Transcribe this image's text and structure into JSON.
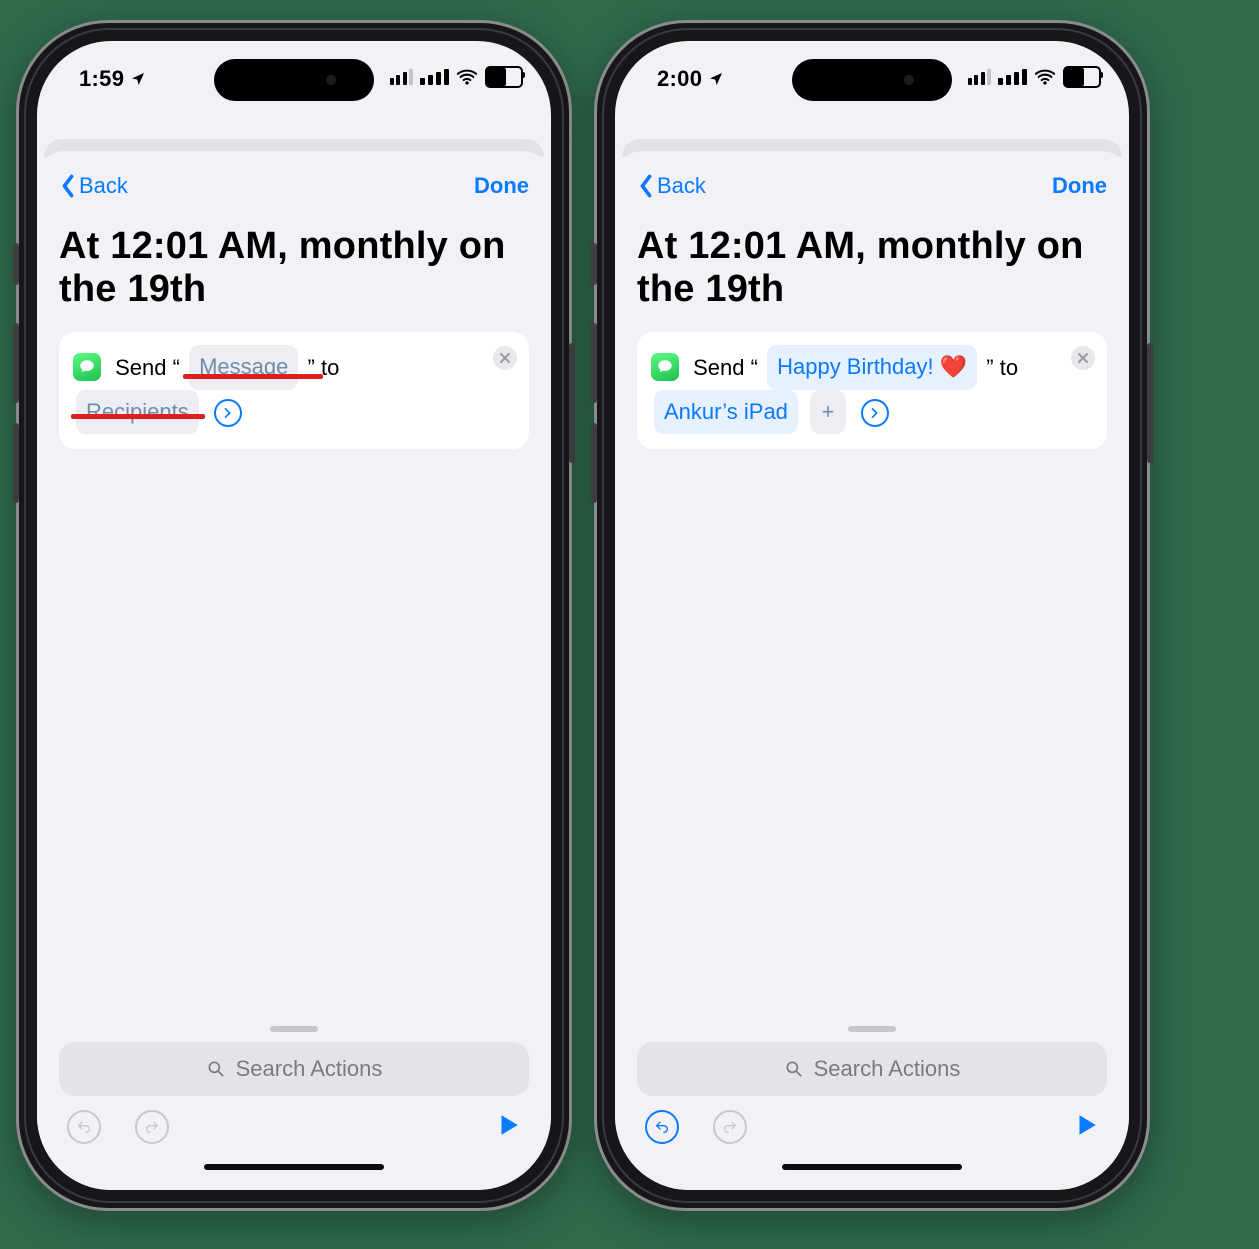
{
  "phones": {
    "left": {
      "status": {
        "time": "1:59"
      },
      "nav": {
        "back": "Back",
        "done": "Done"
      },
      "title": "At 12:01 AM, monthly on the 19th",
      "card": {
        "send_prefix": "Send",
        "quote_open": "“",
        "message_placeholder": "Message",
        "quote_close": "”",
        "to": "to",
        "recipients_placeholder": "Recipients"
      },
      "search_placeholder": "Search Actions"
    },
    "right": {
      "status": {
        "time": "2:00"
      },
      "nav": {
        "back": "Back",
        "done": "Done"
      },
      "title": "At 12:01 AM, monthly on the 19th",
      "card": {
        "send_prefix": "Send",
        "quote_open": "“",
        "message_value": "Happy Birthday! ❤️",
        "quote_close": "”",
        "to": "to",
        "recipient_value": "Ankur’s iPad",
        "add_label": "+"
      },
      "search_placeholder": "Search Actions"
    }
  }
}
